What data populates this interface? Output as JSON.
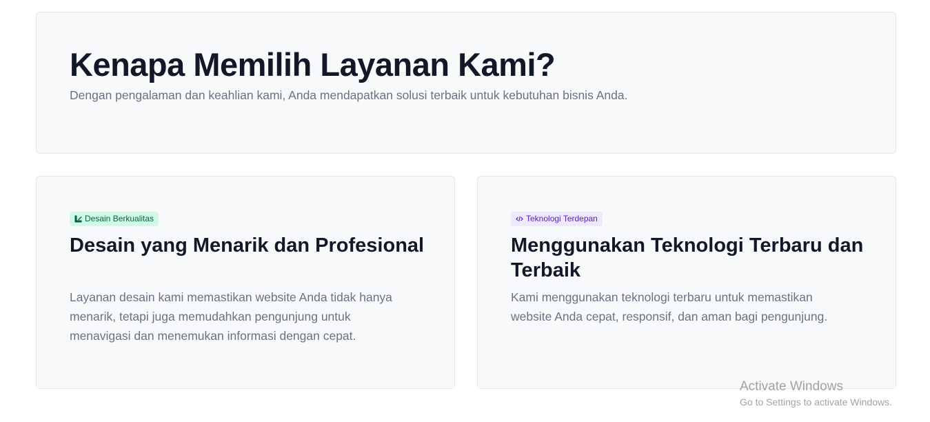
{
  "hero": {
    "title": "Kenapa Memilih Layanan Kami?",
    "subtitle": "Dengan pengalaman dan keahlian kami, Anda mendapatkan solusi terbaik untuk kebutuhan bisnis Anda."
  },
  "cards": [
    {
      "badge": {
        "label": "Desain Berkualitas",
        "icon": "design-icon",
        "color": "#065f46",
        "background": "#d1fae5"
      },
      "title": "Desain yang Menarik dan Profesional",
      "description": "Layanan desain kami memastikan website Anda tidak hanya menarik, tetapi juga memudahkan pengunjung untuk menavigasi dan menemukan informasi dengan cepat."
    },
    {
      "badge": {
        "label": "Teknologi Terdepan",
        "icon": "code-icon",
        "color": "#5b21b6",
        "background": "#ede9fe"
      },
      "title": "Menggunakan Teknologi Terbaru dan Terbaik",
      "description": "Kami menggunakan teknologi terbaru untuk memastikan website Anda cepat, responsif, dan aman bagi pengunjung."
    }
  ],
  "watermark": {
    "title": "Activate Windows",
    "subtitle": "Go to Settings to activate Windows."
  }
}
